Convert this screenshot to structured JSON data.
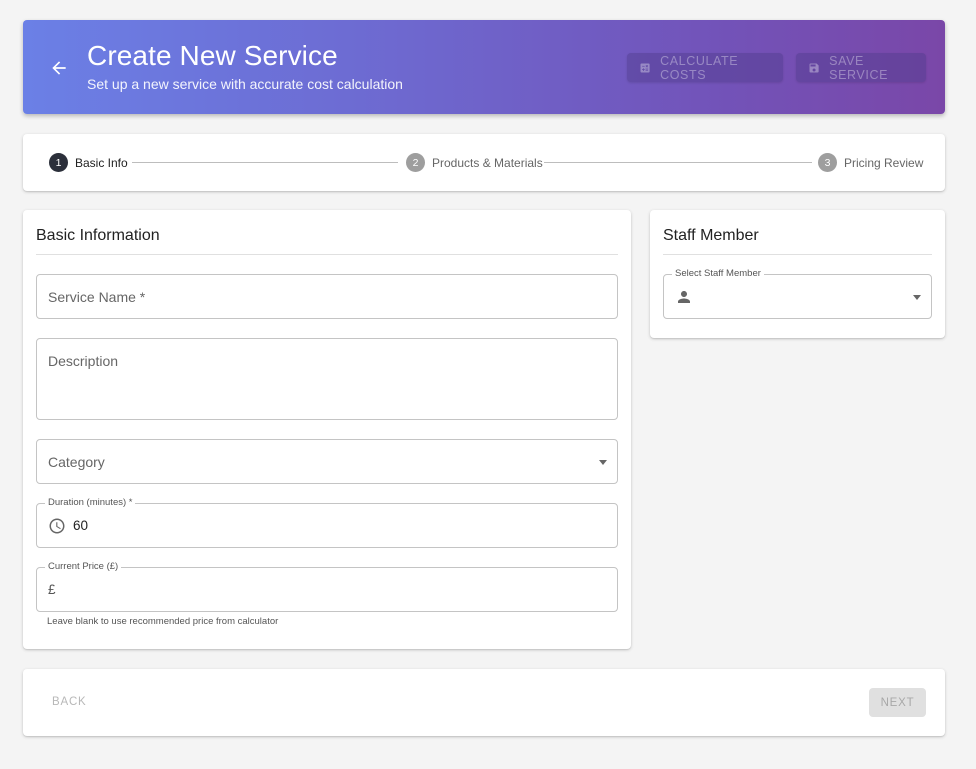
{
  "header": {
    "title": "Create New Service",
    "subtitle": "Set up a new service with accurate cost calculation",
    "calculate_label": "CALCULATE COSTS",
    "save_label": "SAVE SERVICE",
    "gradient_start": "#6b80e6",
    "gradient_end": "#7a47a8"
  },
  "stepper": {
    "steps": [
      {
        "number": "1",
        "label": "Basic Info",
        "state": "active"
      },
      {
        "number": "2",
        "label": "Products & Materials",
        "state": "inactive"
      },
      {
        "number": "3",
        "label": "Pricing Review",
        "state": "inactive"
      }
    ]
  },
  "basic_info": {
    "title": "Basic Information",
    "service_name_placeholder": "Service Name *",
    "description_placeholder": "Description",
    "category_placeholder": "Category",
    "duration_label": "Duration (minutes) *",
    "duration_value": "60",
    "price_label": "Current Price (£)",
    "price_prefix": "£",
    "price_helper": "Leave blank to use recommended price from calculator"
  },
  "staff": {
    "title": "Staff Member",
    "select_label": "Select Staff Member"
  },
  "footer": {
    "back_label": "BACK",
    "next_label": "NEXT"
  },
  "icons": {
    "back": "arrow-left-icon",
    "calculate": "calculator-icon",
    "save": "save-icon",
    "clock": "clock-icon",
    "person": "person-icon",
    "dropdown": "chevron-down-icon"
  }
}
